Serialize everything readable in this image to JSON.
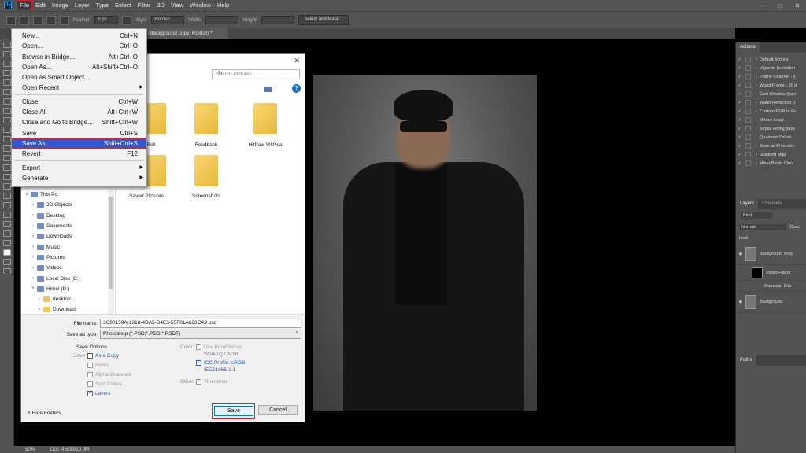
{
  "menubar": {
    "logo": "Ps",
    "items": [
      "File",
      "Edit",
      "Image",
      "Layer",
      "Type",
      "Select",
      "Filter",
      "3D",
      "View",
      "Window",
      "Help"
    ]
  },
  "options": {
    "feather_label": "Feather:",
    "feather_value": "0 px",
    "style_label": "Style:",
    "style_value": "Normal",
    "width_label": "Width:",
    "height_label": "Height:",
    "select_mask": "Select and Mask..."
  },
  "doc_tab": "(Background copy, RGB/8) *",
  "file_menu": [
    {
      "label": "New...",
      "shortcut": "Ctrl+N"
    },
    {
      "label": "Open...",
      "shortcut": "Ctrl+O"
    },
    {
      "label": "Browse in Bridge...",
      "shortcut": "Alt+Ctrl+O"
    },
    {
      "label": "Open As...",
      "shortcut": "Alt+Shift+Ctrl+O"
    },
    {
      "label": "Open as Smart Object...",
      "shortcut": ""
    },
    {
      "label": "Open Recent",
      "shortcut": ""
    },
    {
      "label": "Close",
      "shortcut": "Ctrl+W"
    },
    {
      "label": "Close All",
      "shortcut": "Alt+Ctrl+W"
    },
    {
      "label": "Close and Go to Bridge...",
      "shortcut": "Shift+Ctrl+W"
    },
    {
      "label": "Save",
      "shortcut": "Ctrl+S"
    },
    {
      "label": "Save As...",
      "shortcut": "Shift+Ctrl+S"
    },
    {
      "label": "Revert",
      "shortcut": "F12"
    },
    {
      "label": "Export",
      "shortcut": ""
    },
    {
      "label": "Generate",
      "shortcut": ""
    }
  ],
  "dialog": {
    "search_placeholder": "Search Pictures",
    "folders": [
      {
        "label": "Roll"
      },
      {
        "label": "Feedback"
      },
      {
        "label": "HitPaw VikPea"
      },
      {
        "label": "Saved Pictures"
      },
      {
        "label": "Screenshots"
      }
    ],
    "nav": [
      {
        "label": "This Pc"
      },
      {
        "label": "3D Objects"
      },
      {
        "label": "Desktop"
      },
      {
        "label": "Documents"
      },
      {
        "label": "Downloads"
      },
      {
        "label": "Music"
      },
      {
        "label": "Pictures"
      },
      {
        "label": "Videos"
      },
      {
        "label": "Local Disk (C:)"
      },
      {
        "label": "Himel  (D:)"
      },
      {
        "label": "desktop"
      },
      {
        "label": "Download"
      }
    ],
    "file_name_label": "File name:",
    "file_name_value": "3C90159A-1318-4DA5-B4E3-55F01A623CA9.psd",
    "save_type_label": "Save as type:",
    "save_type_value": "Photoshop (*.PSD;*.PDD;*.PSDT)",
    "save_options_title": "Save Options",
    "save_label": "Save:",
    "as_copy": "As a Copy",
    "notes": "Notes",
    "alpha": "Alpha Channels",
    "spot": "Spot Colors",
    "layers": "Layers",
    "color_label": "Color:",
    "proof": "Use Proof Setup:",
    "proof_sub": "Working CMYK",
    "icc": "ICC Profile:  sRGB",
    "icc_sub": "IEC61966-2.1",
    "other_label": "Other:",
    "thumbnail": "Thumbnail",
    "hide_folders": "Hide Folders",
    "save_button": "Save",
    "cancel_button": "Cancel"
  },
  "actions_panel": {
    "tab": "Actions",
    "items": [
      {
        "label": "Default Actions"
      },
      {
        "label": "Vignette (selection"
      },
      {
        "label": "Frame Channel - 5"
      },
      {
        "label": "Wood Frame - 50 p"
      },
      {
        "label": "Cast Shadow (type"
      },
      {
        "label": "Water Reflection (t"
      },
      {
        "label": "Custom RGB to Gr"
      },
      {
        "label": "Molten Lead"
      },
      {
        "label": "Sepia Toning (laye"
      },
      {
        "label": "Quadrant Colors"
      },
      {
        "label": "Save as Photosho"
      },
      {
        "label": "Gradient Map"
      },
      {
        "label": "Mixer Brush Cloni"
      }
    ]
  },
  "layers_panel": {
    "tabs": [
      "Layers",
      "Channels"
    ],
    "kind": "Kind",
    "blend": "Normal",
    "opacity": "Opac",
    "lock": "Lock:",
    "layers": [
      {
        "label": "Background copy"
      },
      {
        "label": "Smart Filters"
      },
      {
        "label": "Gaussian Blur"
      },
      {
        "label": "Background"
      }
    ]
  },
  "paths_panel": {
    "tab": "Paths"
  },
  "status": {
    "zoom": "50%",
    "doc": "Doc: 4.50M/10.0M"
  }
}
